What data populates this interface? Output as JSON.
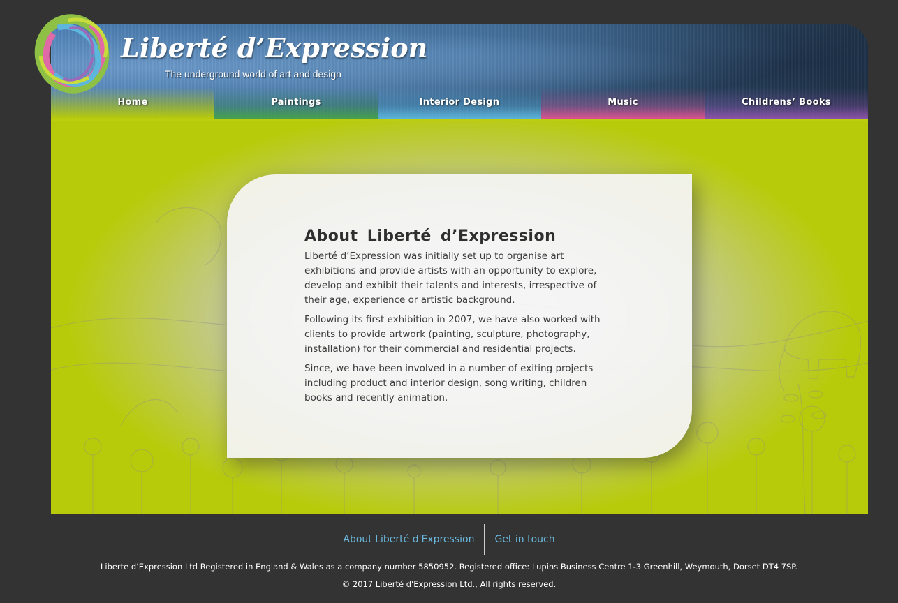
{
  "brand": {
    "title": "Liberté d’Expression",
    "tagline": "The underground world of art and design",
    "logo_icon": "paint-ring-icon"
  },
  "nav": {
    "items": [
      {
        "label": "Home",
        "color": "#b8cb0a"
      },
      {
        "label": "Paintings",
        "color": "#45a04c"
      },
      {
        "label": "Interior  Design",
        "color": "#5bb3da"
      },
      {
        "label": "Music",
        "color": "#d9528f"
      },
      {
        "label": "Childrens’  Books",
        "color": "#8a52a8"
      }
    ]
  },
  "about": {
    "title": "About  Liberté  d’Expression",
    "paragraphs": [
      "Liberté d’Expression was initially set up to organise art exhibitions and provide artists with an opportunity to explore, develop and exhibit their talents and interests, irrespective of their age, experience or artistic background.",
      "Following its first exhibition in 2007, we have also worked with clients to provide artwork (painting, sculpture, photography, installation) for their commercial and residential projects.",
      "Since, we have been involved in a number of exiting projects including product and interior design, song writing, children books and recently animation."
    ]
  },
  "footer": {
    "links": [
      {
        "label": "About Liberté d'Expression"
      },
      {
        "label": "Get in touch"
      }
    ],
    "registration": "Liberte d’Expression Ltd Registered in England & Wales as a company number 5850952. Registered office: Lupins Business Centre 1-3 Greenhill, Weymouth, Dorset DT4 7SP.",
    "copyright": "© 2017 Liberté d'Expression Ltd., All rights reserved."
  },
  "colors": {
    "background": "#333333",
    "accent_lime": "#b8cb0a",
    "link": "#6ab8de"
  }
}
